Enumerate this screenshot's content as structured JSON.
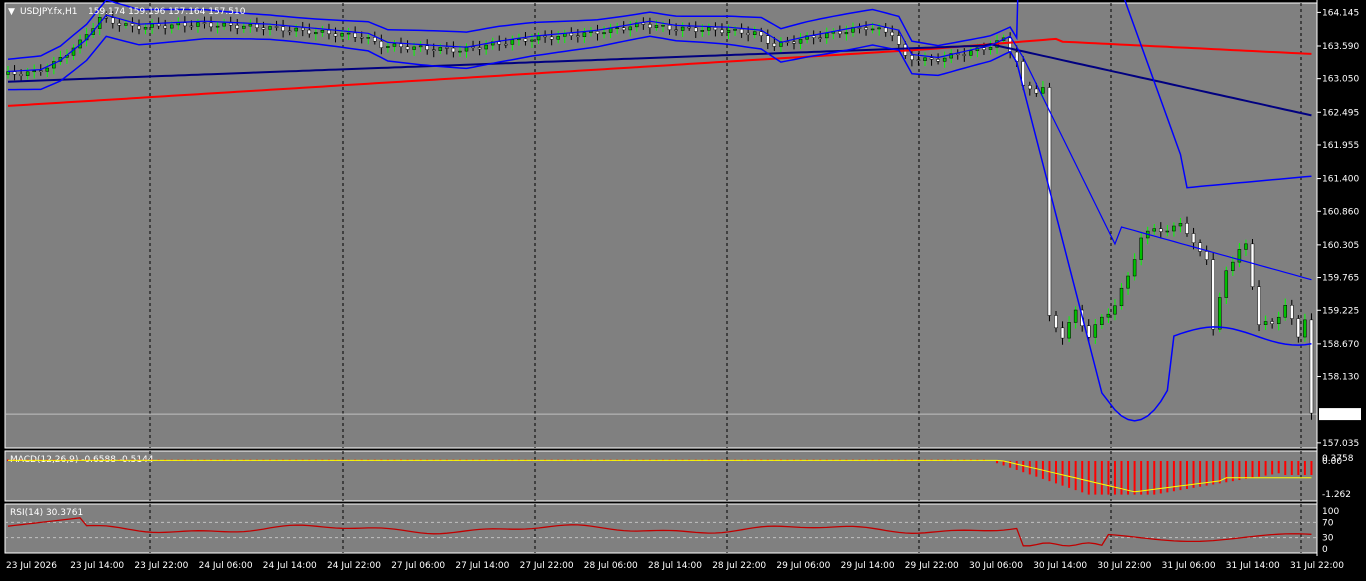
{
  "window": {
    "symbol_label": "USDJPY.fx,H1",
    "ohlc_label": "159.174 159.196 157.164 157.510",
    "collapse_marker": "▼"
  },
  "colors": {
    "background": "#000000",
    "plot_background": "#808080",
    "bull_candle": "#00c000",
    "bear_candle": "#ffffff",
    "bollinger": "#0000ff",
    "ma_fast": "#000080",
    "ma_slow": "#ff0000",
    "macd_histogram": "#ff0000",
    "macd_signal": "#ffff00",
    "rsi_line": "#c00000",
    "grid": "#000000",
    "bid_line": "#c0c0c0"
  },
  "main_chart": {
    "price_ticks": [
      "164.145",
      "163.590",
      "163.050",
      "162.495",
      "161.955",
      "161.400",
      "160.860",
      "160.305",
      "159.765",
      "159.225",
      "158.670",
      "158.130",
      "157.035"
    ],
    "current_price_label": "157.510",
    "ylim": [
      156.95,
      164.3
    ]
  },
  "macd": {
    "label": "MACD(12,26,9) -0.6588 -0.5144",
    "ticks": [
      "0.3758",
      "0.00",
      "-1.262"
    ]
  },
  "rsi": {
    "label": "RSI(14) 30.3761",
    "ticks": [
      "100",
      "70",
      "30",
      "0"
    ]
  },
  "time_axis": {
    "labels": [
      "23 Jul 2026",
      "23 Jul 14:00",
      "23 Jul 22:00",
      "24 Jul 06:00",
      "24 Jul 14:00",
      "24 Jul 22:00",
      "27 Jul 06:00",
      "27 Jul 14:00",
      "27 Jul 22:00",
      "28 Jul 06:00",
      "28 Jul 14:00",
      "28 Jul 22:00",
      "29 Jul 06:00",
      "29 Jul 14:00",
      "29 Jul 22:00",
      "30 Jul 06:00",
      "30 Jul 14:00",
      "30 Jul 22:00",
      "31 Jul 06:00",
      "31 Jul 14:00",
      "31 Jul 22:00"
    ]
  }
}
